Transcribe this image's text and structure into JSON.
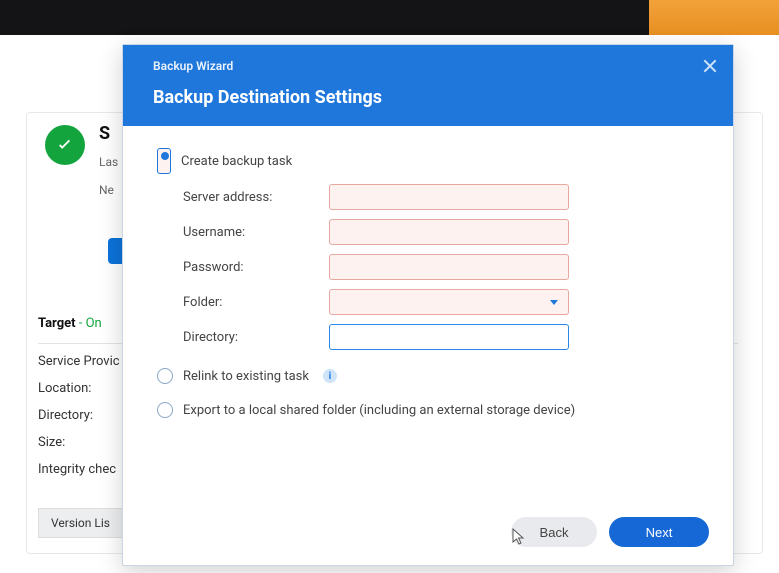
{
  "background": {
    "status_title_letter": "S",
    "last_line1": "Las",
    "last_line2": "Ne",
    "target_label": "Target",
    "target_status": "- On",
    "rows": {
      "service": "Service Provic",
      "location": "Location:",
      "directory": "Directory:",
      "size": "Size:",
      "integrity": "Integrity chec"
    },
    "version_button": "Version Lis"
  },
  "modal": {
    "wizard": "Backup Wizard",
    "title": "Backup Destination Settings",
    "option_create": "Create backup task",
    "fields": {
      "server": "Server address:",
      "username": "Username:",
      "password": "Password:",
      "folder": "Folder:",
      "directory": "Directory:"
    },
    "option_relink": "Relink to existing task",
    "option_export": "Export to a local shared folder (including an external storage device)",
    "buttons": {
      "back": "Back",
      "next": "Next"
    }
  }
}
